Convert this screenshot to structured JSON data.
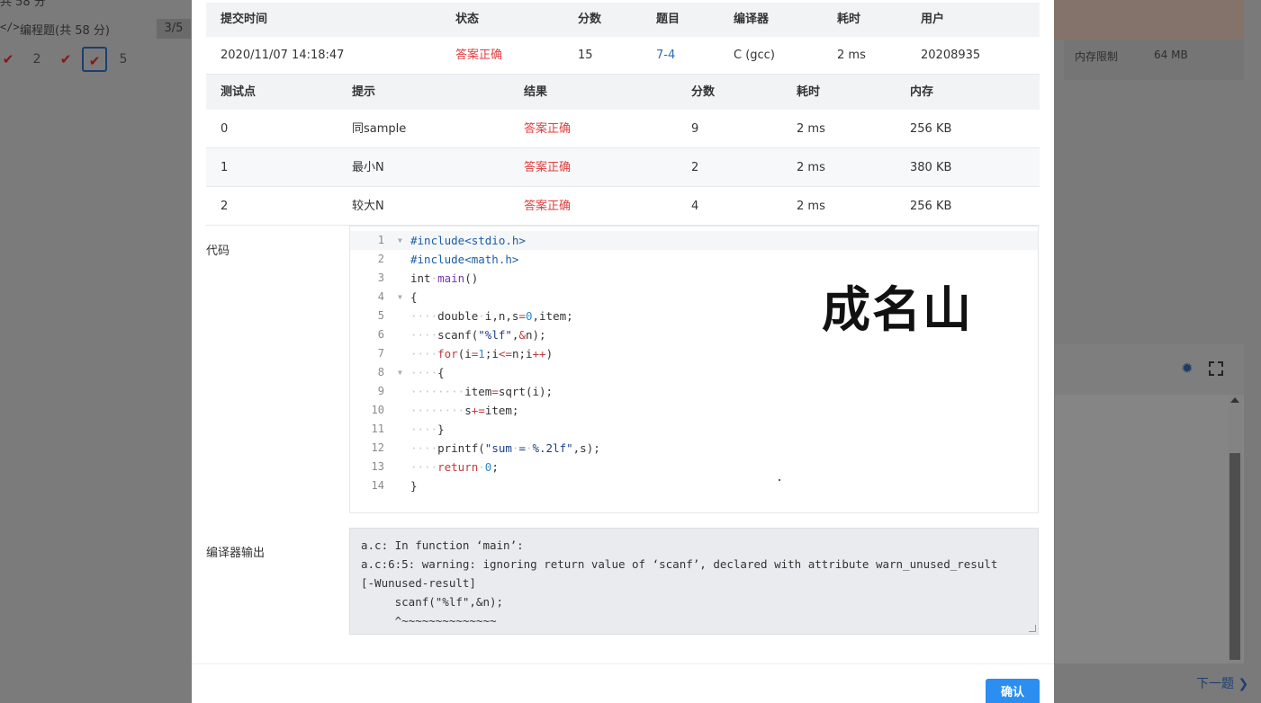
{
  "background": {
    "score_partial": "共 58 分",
    "program_label": "编程题",
    "program_points": "(共 58 分)",
    "progress": "3/5",
    "question_numbers": [
      "2",
      "5"
    ],
    "memory_limit_label": "内存限制",
    "memory_limit_value": "64 MB",
    "next_link": "下一题"
  },
  "submission": {
    "headers": [
      "提交时间",
      "状态",
      "分数",
      "题目",
      "编译器",
      "耗时",
      "用户"
    ],
    "row": {
      "time": "2020/11/07 14:18:47",
      "status": "答案正确",
      "score": "15",
      "problem": "7-4",
      "compiler": "C (gcc)",
      "elapsed": "2 ms",
      "user": "20208935"
    }
  },
  "testcases": {
    "headers": [
      "测试点",
      "提示",
      "结果",
      "分数",
      "耗时",
      "内存"
    ],
    "rows": [
      {
        "id": "0",
        "hint": "同sample",
        "result": "答案正确",
        "score": "9",
        "time": "2 ms",
        "memory": "256 KB"
      },
      {
        "id": "1",
        "hint": "最小N",
        "result": "答案正确",
        "score": "2",
        "time": "2 ms",
        "memory": "380 KB"
      },
      {
        "id": "2",
        "hint": "较大N",
        "result": "答案正确",
        "score": "4",
        "time": "2 ms",
        "memory": "256 KB"
      }
    ]
  },
  "code_label": "代码",
  "compiler_output_label": "编译器输出",
  "signature": "成名山",
  "code_line_numbers": [
    "1",
    "2",
    "3",
    "4",
    "5",
    "6",
    "7",
    "8",
    "9",
    "10",
    "11",
    "12",
    "13",
    "14"
  ],
  "compiler_output": "a.c: In function ‘main’:\na.c:6:5: warning: ignoring return value of ‘scanf’, declared with attribute warn_unused_result\n[-Wunused-result]\n     scanf(\"%lf\",&n);\n     ^~~~~~~~~~~~~~~",
  "confirm_button": "确认",
  "colors": {
    "accent": "#2b8ef0",
    "status_ok": "#e23e3e",
    "link": "#2a6db3",
    "header_bg": "#f2f3f5"
  }
}
